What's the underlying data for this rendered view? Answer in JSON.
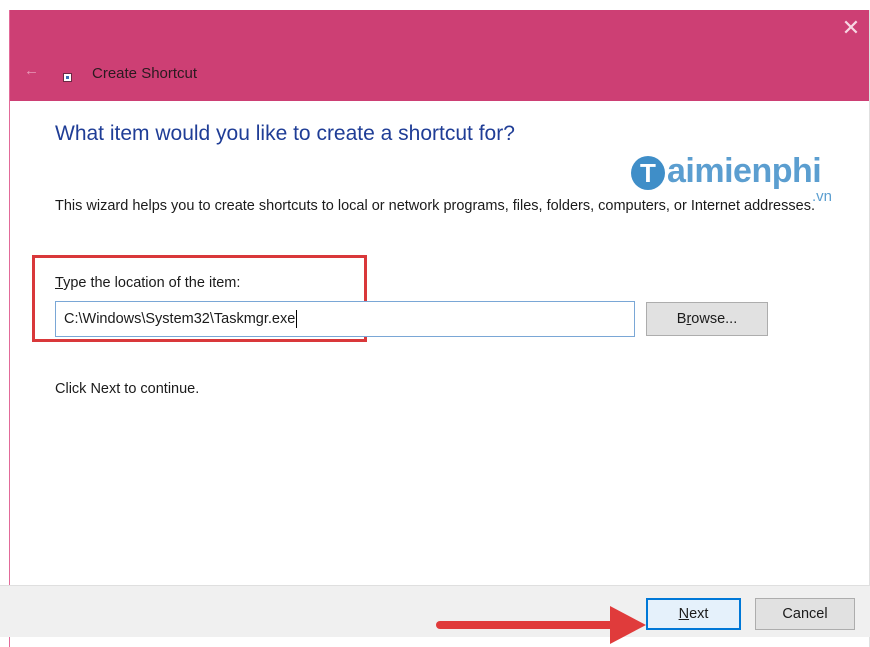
{
  "window": {
    "title": "Create Shortcut",
    "close_glyph": "✕",
    "back_glyph": "←",
    "titlebar_color": "#cd3f74"
  },
  "content": {
    "heading": "What item would you like to create a shortcut for?",
    "description": "This wizard helps you to create shortcuts to local or network programs, files, folders, computers, or Internet addresses.",
    "field_label_mnemonic": "T",
    "field_label_rest": "ype the location of the item:",
    "location_value": "C:\\Windows\\System32\\Taskmgr.exe",
    "browse_mnemonic": "r",
    "browse_prefix": "B",
    "browse_suffix": "owse...",
    "continue_text": "Click Next to continue."
  },
  "watermark": {
    "logo_letter": "T",
    "text": "aimienphi",
    "suffix": ".vn"
  },
  "footer": {
    "next_mnemonic": "N",
    "next_rest": "ext",
    "cancel_label": "Cancel"
  },
  "annotations": {
    "highlight_color": "#d9383a",
    "arrow_color": "#e03b3b"
  },
  "icons": [
    "back-arrow-icon",
    "shortcut-app-icon",
    "close-icon"
  ]
}
